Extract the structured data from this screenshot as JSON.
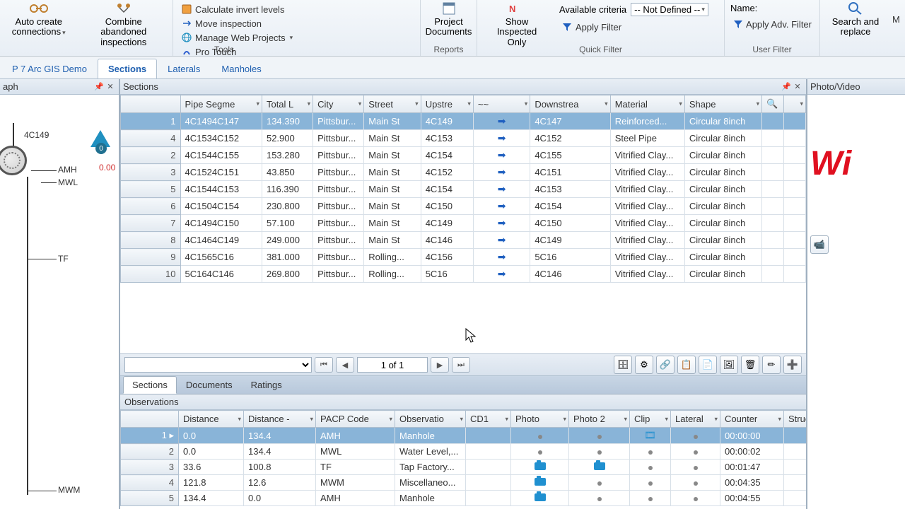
{
  "ribbon": {
    "tools": {
      "auto_create": "Auto create connections",
      "combine": "Combine abandoned inspections",
      "calc_invert": "Calculate invert levels",
      "move_inspection": "Move inspection",
      "manage_web": "Manage Web Projects",
      "pro_touch": "Pro Touch",
      "group_label": "Tools"
    },
    "reports": {
      "project_docs": "Project Documents",
      "group_label": "Reports"
    },
    "quick_filter": {
      "show_inspected": "Show Inspected Only",
      "available_criteria_label": "Available criteria",
      "criteria_value": "-- Not Defined --",
      "apply_filter": "Apply Filter",
      "group_label": "Quick Filter"
    },
    "user_filter": {
      "name_label": "Name:",
      "apply_adv": "Apply Adv. Filter",
      "group_label": "User Filter"
    },
    "search": {
      "search_replace": "Search and replace"
    }
  },
  "doc_tabs": {
    "t0": "P 7 Arc GIS Demo",
    "t1": "Sections",
    "t2": "Laterals",
    "t3": "Manholes"
  },
  "left_pane": {
    "title": "aph",
    "node_id": "4C149",
    "warn_count": "0",
    "value_red": "0.00",
    "label_amh": "AMH",
    "label_mwl": "MWL",
    "label_tf": "TF",
    "label_mwm": "MWM"
  },
  "sections_pane": {
    "title": "Sections",
    "columns": {
      "pipe": "Pipe Segme",
      "total": "Total L",
      "city": "City",
      "street": "Street",
      "upstre": "Upstre",
      "dir": "~~",
      "down": "Downstrea",
      "material": "Material",
      "shape": "Shape"
    },
    "rows": [
      {
        "n": "1",
        "pipe": "4C1494C147",
        "total": "134.390",
        "city": "Pittsbur...",
        "street": "Main St",
        "up": "4C149",
        "down": "4C147",
        "mat": "Reinforced...",
        "shape": "Circular 8inch",
        "sel": true
      },
      {
        "n": "4",
        "pipe": "4C1534C152",
        "total": "52.900",
        "city": "Pittsbur...",
        "street": "Main St",
        "up": "4C153",
        "down": "4C152",
        "mat": "Steel Pipe",
        "shape": "Circular 8inch"
      },
      {
        "n": "2",
        "pipe": "4C1544C155",
        "total": "153.280",
        "city": "Pittsbur...",
        "street": "Main St",
        "up": "4C154",
        "down": "4C155",
        "mat": "Vitrified  Clay...",
        "shape": "Circular 8inch"
      },
      {
        "n": "3",
        "pipe": "4C1524C151",
        "total": "43.850",
        "city": "Pittsbur...",
        "street": "Main St",
        "up": "4C152",
        "down": "4C151",
        "mat": "Vitrified  Clay...",
        "shape": "Circular 8inch"
      },
      {
        "n": "5",
        "pipe": "4C1544C153",
        "total": "116.390",
        "city": "Pittsbur...",
        "street": "Main St",
        "up": "4C154",
        "down": "4C153",
        "mat": "Vitrified  Clay...",
        "shape": "Circular 8inch"
      },
      {
        "n": "6",
        "pipe": "4C1504C154",
        "total": "230.800",
        "city": "Pittsbur...",
        "street": "Main St",
        "up": "4C150",
        "down": "4C154",
        "mat": "Vitrified  Clay...",
        "shape": "Circular 8inch"
      },
      {
        "n": "7",
        "pipe": "4C1494C150",
        "total": "57.100",
        "city": "Pittsbur...",
        "street": "Main St",
        "up": "4C149",
        "down": "4C150",
        "mat": "Vitrified  Clay...",
        "shape": "Circular 8inch"
      },
      {
        "n": "8",
        "pipe": "4C1464C149",
        "total": "249.000",
        "city": "Pittsbur...",
        "street": "Main St",
        "up": "4C146",
        "down": "4C149",
        "mat": "Vitrified  Clay...",
        "shape": "Circular 8inch"
      },
      {
        "n": "9",
        "pipe": "4C1565C16",
        "total": "381.000",
        "city": "Pittsbur...",
        "street": "Rolling...",
        "up": "4C156",
        "down": "5C16",
        "mat": "Vitrified  Clay...",
        "shape": "Circular 8inch"
      },
      {
        "n": "10",
        "pipe": "5C164C146",
        "total": "269.800",
        "city": "Pittsbur...",
        "street": "Rolling...",
        "up": "5C16",
        "down": "4C146",
        "mat": "Vitrified  Clay...",
        "shape": "Circular 8inch"
      }
    ],
    "page_indicator": "1 of 1",
    "sub_tabs": {
      "sections": "Sections",
      "documents": "Documents",
      "ratings": "Ratings"
    }
  },
  "observations": {
    "title": "Observations",
    "columns": {
      "dist": "Distance",
      "dist2": "Distance -",
      "pacp": "PACP Code",
      "obs": "Observatio",
      "cd1": "CD1",
      "photo": "Photo",
      "photo2": "Photo 2",
      "clip": "Clip",
      "lateral": "Lateral",
      "counter": "Counter",
      "grade": "Struct. Grade"
    },
    "rows": [
      {
        "n": "1",
        "d": "0.0",
        "d2": "134.4",
        "pacp": "AMH",
        "obs": "Manhole",
        "p": "dot",
        "p2": "dot",
        "clip": "clip",
        "lat": "dot",
        "ctr": "00:00:00",
        "sel": true,
        "cur": true
      },
      {
        "n": "2",
        "d": "0.0",
        "d2": "134.4",
        "pacp": "MWL",
        "obs": "Water  Level,...",
        "p": "dot",
        "p2": "dot",
        "clip": "dot",
        "lat": "dot",
        "ctr": "00:00:02"
      },
      {
        "n": "3",
        "d": "33.6",
        "d2": "100.8",
        "pacp": "TF",
        "obs": "Tap  Factory...",
        "p": "cam",
        "p2": "cam",
        "clip": "dot",
        "lat": "dot",
        "ctr": "00:01:47"
      },
      {
        "n": "4",
        "d": "121.8",
        "d2": "12.6",
        "pacp": "MWM",
        "obs": "Miscellaneo...",
        "p": "cam",
        "p2": "dot",
        "clip": "dot",
        "lat": "dot",
        "ctr": "00:04:35"
      },
      {
        "n": "5",
        "d": "134.4",
        "d2": "0.0",
        "pacp": "AMH",
        "obs": "Manhole",
        "p": "cam",
        "p2": "dot",
        "clip": "dot",
        "lat": "dot",
        "ctr": "00:04:55"
      }
    ]
  },
  "right_pane": {
    "title": "Photo/Video",
    "watermark": "Wi"
  }
}
